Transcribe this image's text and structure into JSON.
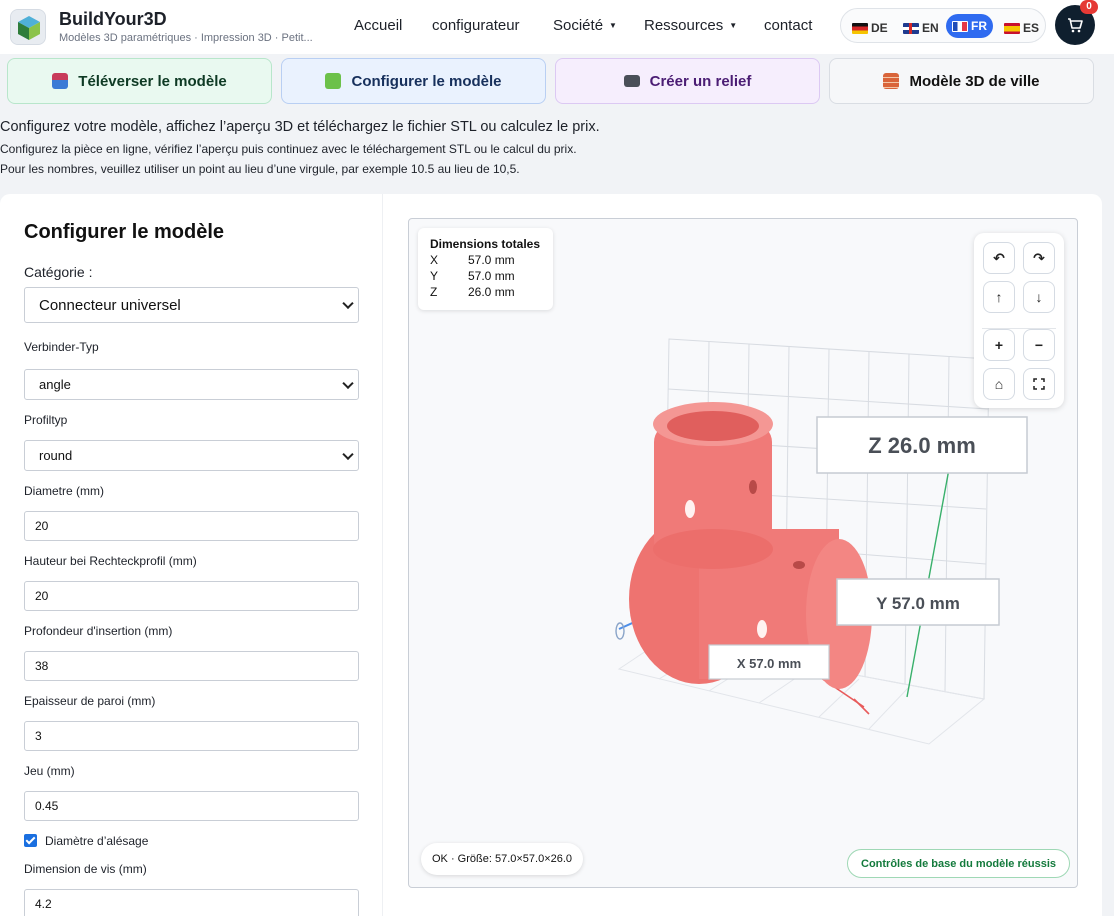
{
  "header": {
    "brand_title": "BuildYour3D",
    "brand_subtitle": "Modèles 3D paramétriques · Impression 3D · Petit...",
    "nav": [
      {
        "label": "Accueil",
        "dropdown": false
      },
      {
        "label": "configurateur",
        "dropdown": false
      },
      {
        "label": "Société",
        "dropdown": true
      },
      {
        "label": "Ressources",
        "dropdown": true
      },
      {
        "label": "contact",
        "dropdown": false
      }
    ],
    "languages": [
      {
        "code": "DE",
        "active": false
      },
      {
        "code": "EN",
        "active": false
      },
      {
        "code": "FR",
        "active": true
      },
      {
        "code": "ES",
        "active": false
      }
    ],
    "cart_count": "0",
    "accent_color": "#2f6bf0"
  },
  "tabs": [
    {
      "label": "Téléverser le modèle",
      "icon": "upload-icon",
      "bg": "#e9f9f0",
      "border": "#b8e6cb",
      "color": "#0e3a24"
    },
    {
      "label": "Configurer le modèle",
      "icon": "puzzle-icon",
      "bg": "#eaf2fe",
      "border": "#b9cff3",
      "color": "#17305c"
    },
    {
      "label": "Créer un relief",
      "icon": "camera-icon",
      "bg": "#f6eefd",
      "border": "#dcc9f3",
      "color": "#4b1d74"
    },
    {
      "label": "Modèle 3D de ville",
      "icon": "brick-icon",
      "bg": "#f6f7f9",
      "border": "#d9dde3",
      "color": "#111111"
    }
  ],
  "intro": {
    "line1": "Configurez votre modèle, affichez l’aperçu 3D et téléchargez le fichier STL ou calculez le prix.",
    "line2": "Configurez la pièce en ligne, vérifiez l’aperçu puis continuez avec le téléchargement STL ou le calcul du prix.",
    "line3": "Pour les nombres, veuillez utiliser un point au lieu d’une virgule, par exemple 10.5 au lieu de 10,5."
  },
  "form": {
    "title": "Configurer le modèle",
    "category_label": "Catégorie :",
    "category_value": "Connecteur universel",
    "connector_type_label": "Verbinder-Typ",
    "connector_type_value": "angle",
    "profile_type_label": "Profiltyp",
    "profile_type_value": "round",
    "diameter_label": "Diametre (mm)",
    "diameter_value": "20",
    "rect_height_label": "Hauteur bei Rechteckprofil (mm)",
    "rect_height_value": "20",
    "insert_depth_label": "Profondeur d'insertion (mm)",
    "insert_depth_value": "38",
    "wall_label": "Epaisseur de paroi (mm)",
    "wall_value": "3",
    "clearance_label": "Jeu (mm)",
    "clearance_value": "0.45",
    "bore_checkbox_label": "Diamètre d’alésage",
    "bore_checked": true,
    "screw_label": "Dimension de vis (mm)",
    "screw_value": "4.2"
  },
  "viewer": {
    "dims_title": "Dimensions totales",
    "dims": [
      {
        "axis": "X",
        "value": "57.0 mm"
      },
      {
        "axis": "Y",
        "value": "57.0 mm"
      },
      {
        "axis": "Z",
        "value": "26.0 mm"
      }
    ],
    "label_z": "Z 26.0 mm",
    "label_y": "Y 57.0 mm",
    "label_x": "X 57.0 mm",
    "status_text": "OK · Größe: 57.0×57.0×26.0",
    "checks_text": "Contrôles de base du modèle réussis",
    "model_color": "#f07a78",
    "controls": [
      "rotate-left-icon",
      "rotate-right-icon",
      "arrow-up-icon",
      "arrow-down-icon",
      "zoom-in-icon",
      "zoom-out-icon",
      "home-icon",
      "fullscreen-icon"
    ]
  }
}
